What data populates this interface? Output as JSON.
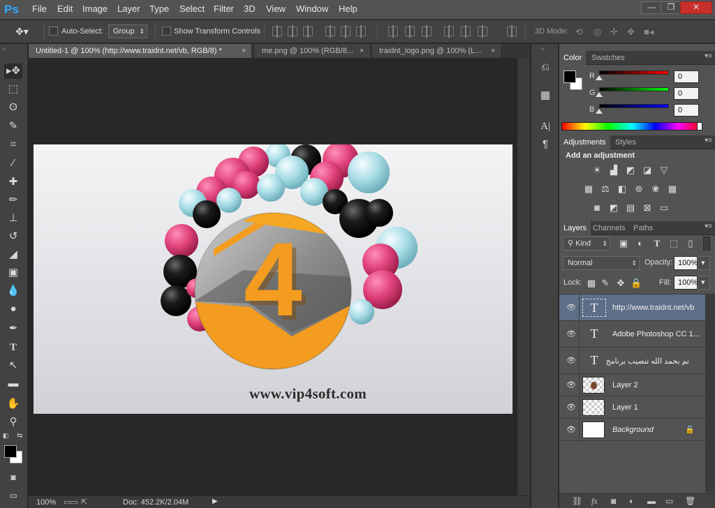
{
  "app": {
    "logo": "Ps"
  },
  "menu": [
    "File",
    "Edit",
    "Image",
    "Layer",
    "Type",
    "Select",
    "Filter",
    "3D",
    "View",
    "Window",
    "Help"
  ],
  "window_controls": {
    "minimize": "—",
    "restore": "❐",
    "close": "✕"
  },
  "options": {
    "auto_select_label": "Auto-Select:",
    "auto_select_value": "Group",
    "show_transform_label": "Show Transform Controls",
    "mode_3d_label": "3D Mode:"
  },
  "tabs": [
    {
      "label": "Untitled-1 @ 100% (http://www.traidnt.net/vb, RGB/8) *",
      "close": "×"
    },
    {
      "label": "me.png @ 100% (RGB/8...",
      "close": "×"
    },
    {
      "label": "traidnt_logo.png @ 100% (L...",
      "close": "×"
    }
  ],
  "canvas": {
    "site_text": "www.vip4soft.com",
    "digit": "4"
  },
  "statusbar": {
    "zoom": "100%",
    "doc": "Doc: 452.2K/2.04M"
  },
  "color_panel": {
    "tabs": [
      "Color",
      "Swatches"
    ],
    "channels": [
      {
        "label": "R",
        "value": "0"
      },
      {
        "label": "G",
        "value": "0"
      },
      {
        "label": "B",
        "value": "0"
      }
    ]
  },
  "adjust_panel": {
    "tabs": [
      "Adjustments",
      "Styles"
    ],
    "heading": "Add an adjustment"
  },
  "layers_panel": {
    "tabs": [
      "Layers",
      "Channels",
      "Paths"
    ],
    "kind_label": "Kind",
    "blend_mode": "Normal",
    "opacity_label": "Opacity:",
    "opacity_value": "100%",
    "lock_label": "Lock:",
    "fill_label": "Fill:",
    "fill_value": "100%",
    "layers": [
      {
        "name": "http://www.traidnt.net/vb",
        "type": "text",
        "thumb": "T"
      },
      {
        "name": "Adobe Photoshop CC 1...",
        "type": "text",
        "thumb": "T"
      },
      {
        "name": "تم بحمد الله تنصيب برنامج",
        "type": "text",
        "thumb": "T"
      },
      {
        "name": "Layer 2",
        "type": "pixel"
      },
      {
        "name": "Layer 1",
        "type": "pixel"
      },
      {
        "name": "Background",
        "type": "background"
      }
    ]
  },
  "colors": {
    "ps_blue": "#31a8ff",
    "selected_layer": "#5d6e88",
    "orange": "#f39c1f",
    "pink": "#e0427a",
    "light_blue": "#a9dde6"
  }
}
